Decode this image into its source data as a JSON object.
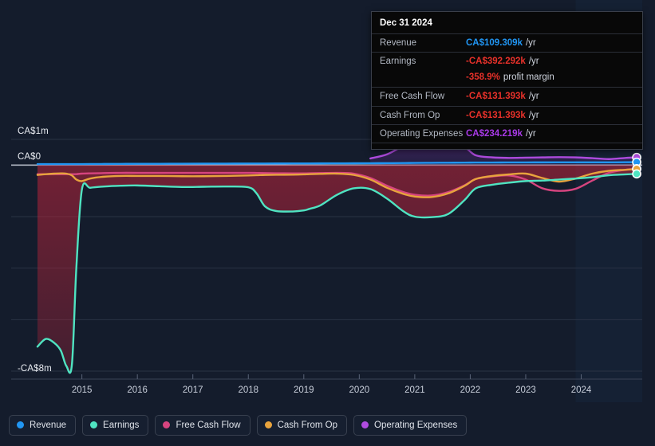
{
  "axis": {
    "y_labels": [
      {
        "text": "CA$1m",
        "value": 1000000
      },
      {
        "text": "CA$0",
        "value": 0
      },
      {
        "text": "-CA$8m",
        "value": -8000000
      }
    ],
    "x_labels": [
      "2015",
      "2016",
      "2017",
      "2018",
      "2019",
      "2020",
      "2021",
      "2022",
      "2023",
      "2024"
    ]
  },
  "tooltip": {
    "date": "Dec 31 2024",
    "rows": [
      {
        "key": "Revenue",
        "value": "CA$109.309k",
        "unit": "/yr",
        "color": "#2196f3"
      },
      {
        "key": "Earnings",
        "value": "-CA$392.292k",
        "unit": "/yr",
        "color": "#e8312a"
      },
      {
        "key": "",
        "value": "-358.9%",
        "unit": "profit margin",
        "color": "#e8312a",
        "sub": true
      },
      {
        "key": "Free Cash Flow",
        "value": "-CA$131.393k",
        "unit": "/yr",
        "color": "#e8312a"
      },
      {
        "key": "Cash From Op",
        "value": "-CA$131.393k",
        "unit": "/yr",
        "color": "#e8312a"
      },
      {
        "key": "Operating Expenses",
        "value": "CA$234.219k",
        "unit": "/yr",
        "color": "#a93ae8"
      }
    ]
  },
  "legend": {
    "items": [
      {
        "label": "Revenue",
        "color": "#2196f3"
      },
      {
        "label": "Earnings",
        "color": "#4fe3c1"
      },
      {
        "label": "Free Cash Flow",
        "color": "#d6447f"
      },
      {
        "label": "Cash From Op",
        "color": "#e8a33d"
      },
      {
        "label": "Operating Expenses",
        "color": "#b04ce0"
      }
    ]
  },
  "chart_data": {
    "type": "area",
    "title": "",
    "xlabel": "",
    "ylabel": "",
    "ylim": [
      -8000000,
      1000000
    ],
    "xlim": [
      2014.2,
      2025.1
    ],
    "grid": true,
    "legend_position": "bottom",
    "y_ticks": [
      1000000,
      0,
      -2000000,
      -4000000,
      -6000000,
      -8000000
    ],
    "x_ticks": [
      2015,
      2016,
      2017,
      2018,
      2019,
      2020,
      2021,
      2022,
      2023,
      2024
    ],
    "forecast_start": 2023.9,
    "x": [
      2014.2,
      2014.35,
      2014.5,
      2014.62,
      2014.72,
      2014.82,
      2014.9,
      2015.0,
      2015.15,
      2015.4,
      2015.7,
      2016.0,
      2016.4,
      2016.8,
      2017.2,
      2017.6,
      2018.0,
      2018.15,
      2018.3,
      2018.5,
      2018.8,
      2019.0,
      2019.1,
      2019.3,
      2019.6,
      2019.9,
      2020.2,
      2020.5,
      2020.8,
      2021.0,
      2021.3,
      2021.6,
      2021.9,
      2022.1,
      2022.4,
      2022.7,
      2023.0,
      2023.3,
      2023.6,
      2023.9,
      2024.2,
      2024.5,
      2024.8,
      2025.0
    ],
    "series": [
      {
        "name": "Revenue",
        "color": "#2196f3",
        "values": [
          40000,
          40000,
          40000,
          40000,
          40000,
          40000,
          40000,
          40000,
          42000,
          45000,
          48000,
          50000,
          52000,
          55000,
          58000,
          60000,
          62000,
          62000,
          63000,
          64000,
          65000,
          66000,
          66000,
          68000,
          70000,
          72000,
          75000,
          78000,
          82000,
          86000,
          90000,
          94000,
          98000,
          100000,
          102000,
          104000,
          106000,
          107000,
          108000,
          108500,
          109000,
          109309,
          112000,
          115000
        ]
      },
      {
        "name": "Earnings",
        "color": "#4fe3c1",
        "values": [
          -7050000,
          -6750000,
          -6900000,
          -7200000,
          -7800000,
          -7750000,
          -4000000,
          -950000,
          -880000,
          -830000,
          -800000,
          -790000,
          -820000,
          -850000,
          -840000,
          -830000,
          -860000,
          -1100000,
          -1600000,
          -1780000,
          -1800000,
          -1760000,
          -1700000,
          -1560000,
          -1150000,
          -900000,
          -930000,
          -1300000,
          -1800000,
          -2000000,
          -2020000,
          -1900000,
          -1350000,
          -900000,
          -760000,
          -680000,
          -620000,
          -600000,
          -560000,
          -520000,
          -470000,
          -392292,
          -360000,
          -340000
        ]
      },
      {
        "name": "Free Cash Flow",
        "color": "#d6447f",
        "values": [
          -350000,
          -350000,
          -350000,
          -350000,
          -350000,
          -350000,
          -350000,
          -330000,
          -320000,
          -310000,
          -300000,
          -300000,
          -300000,
          -300000,
          -300000,
          -300000,
          -300000,
          -305000,
          -310000,
          -315000,
          -320000,
          -320000,
          -318000,
          -310000,
          -300000,
          -330000,
          -500000,
          -800000,
          -1050000,
          -1150000,
          -1180000,
          -1050000,
          -780000,
          -540000,
          -440000,
          -400000,
          -560000,
          -900000,
          -1000000,
          -920000,
          -600000,
          -300000,
          -180000,
          -140000
        ]
      },
      {
        "name": "Cash From Op",
        "color": "#e8a33d",
        "values": [
          -380000,
          -350000,
          -330000,
          -320000,
          -330000,
          -400000,
          -560000,
          -620000,
          -520000,
          -450000,
          -420000,
          -420000,
          -420000,
          -430000,
          -430000,
          -420000,
          -400000,
          -390000,
          -380000,
          -375000,
          -370000,
          -360000,
          -350000,
          -340000,
          -330000,
          -380000,
          -560000,
          -880000,
          -1120000,
          -1220000,
          -1240000,
          -1100000,
          -800000,
          -540000,
          -420000,
          -360000,
          -330000,
          -500000,
          -640000,
          -520000,
          -330000,
          -220000,
          -180000,
          -150000
        ]
      },
      {
        "name": "Operating Expenses",
        "color": "#b04ce0",
        "values": [
          null,
          null,
          null,
          null,
          null,
          null,
          null,
          null,
          null,
          null,
          null,
          null,
          null,
          null,
          null,
          null,
          null,
          null,
          null,
          null,
          null,
          null,
          null,
          null,
          null,
          null,
          260000,
          420000,
          760000,
          980000,
          1020000,
          980000,
          700000,
          380000,
          300000,
          280000,
          290000,
          300000,
          310000,
          300000,
          270000,
          234219,
          280000,
          300000
        ]
      }
    ]
  }
}
